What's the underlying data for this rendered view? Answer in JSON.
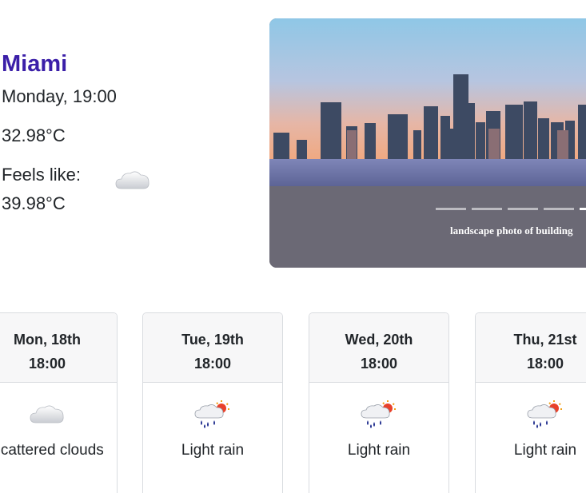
{
  "current": {
    "city": "Miami",
    "datetime": "Monday, 19:00",
    "temperature": "32.98°C",
    "feels_like_label": "Feels like:",
    "feels_like_value": "39.98°C",
    "icon": "cloud-icon"
  },
  "carousel": {
    "caption": "landscape photo of building",
    "indicator_count": 5,
    "active_index": 4
  },
  "forecast": [
    {
      "date": "Mon, 18th",
      "time": "18:00",
      "description": "Scattered clouds",
      "icon": "cloud-icon"
    },
    {
      "date": "Tue, 19th",
      "time": "18:00",
      "description": "Light rain",
      "icon": "sun-rain-cloud-icon"
    },
    {
      "date": "Wed, 20th",
      "time": "18:00",
      "description": "Light rain",
      "icon": "sun-rain-cloud-icon"
    },
    {
      "date": "Thu, 21st",
      "time": "18:00",
      "description": "Light rain",
      "icon": "sun-rain-cloud-icon"
    }
  ],
  "colors": {
    "city": "#3b1fa8",
    "card_header_bg": "#f7f7f8",
    "card_border": "#d9dce0"
  }
}
